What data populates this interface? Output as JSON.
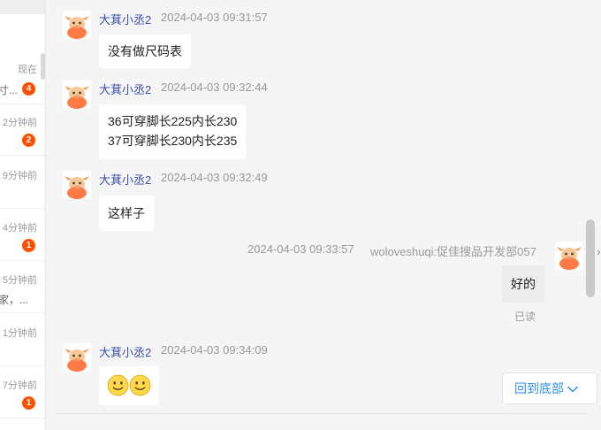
{
  "sidebar": {
    "conversations": [
      {
        "time": "现在",
        "snippet": "寸...",
        "badge": "4"
      },
      {
        "time": "2分钟前",
        "snippet": "",
        "badge": "2"
      },
      {
        "time": "9分钟前",
        "snippet": "",
        "badge": ""
      },
      {
        "time": "4分钟前",
        "snippet": "",
        "badge": "1"
      },
      {
        "time": "5分钟前",
        "snippet": "家，...",
        "badge": ""
      },
      {
        "time": "1分钟前",
        "snippet": "",
        "badge": ""
      },
      {
        "time": "7分钟前",
        "snippet": "",
        "badge": "1"
      }
    ]
  },
  "chat": {
    "messages": [
      {
        "sender": "大萁小丞2",
        "time": "2024-04-03 09:31:57",
        "lines": [
          "没有做尺码表"
        ]
      },
      {
        "sender": "大萁小丞2",
        "time": "2024-04-03 09:32:44",
        "lines": [
          "36可穿脚长225内长230",
          "37可穿脚长230内长235"
        ]
      },
      {
        "sender": "大萁小丞2",
        "time": "2024-04-03 09:32:49",
        "lines": [
          "这样子"
        ]
      },
      {
        "self": true,
        "time": "2024-04-03 09:33:57",
        "sender": "woloveshuqi:促佳搜品开发部057",
        "lines": [
          "好的"
        ],
        "status": "已读"
      },
      {
        "sender": "大萁小丞2",
        "time": "2024-04-03 09:34:09",
        "emoji": [
          "slightly-smiling-face",
          "slightly-smiling-face"
        ]
      }
    ],
    "scroll_to_bottom_label": "回到底部"
  },
  "colors": {
    "accent_blue": "#2f8fe8",
    "badge_orange": "#ff5000",
    "name_blue": "#3b4fa8"
  }
}
